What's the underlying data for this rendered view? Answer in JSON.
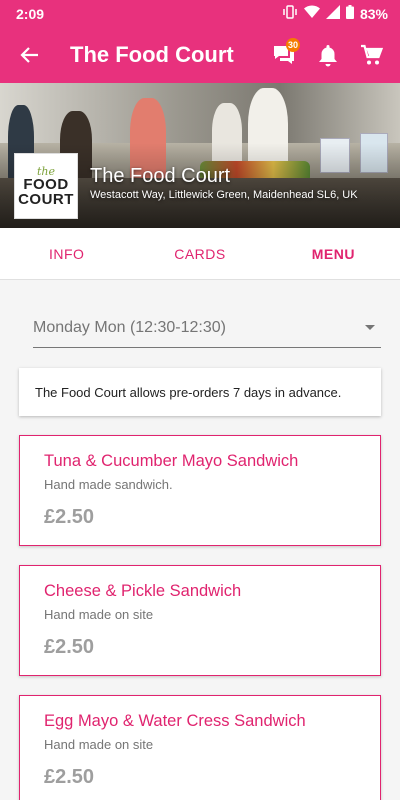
{
  "status": {
    "time": "2:09",
    "battery": "83%"
  },
  "app_bar": {
    "title": "The Food Court",
    "chat_badge": "30"
  },
  "hero": {
    "name": "The Food Court",
    "address": "Westacott Way, Littlewick Green, Maidenhead SL6, UK",
    "logo": {
      "the": "the",
      "food": "FOOD",
      "court": "COURT"
    }
  },
  "tabs": [
    {
      "label": "INFO"
    },
    {
      "label": "CARDS"
    },
    {
      "label": "MENU"
    }
  ],
  "day_select": {
    "value": "Monday Mon (12:30-12:30)"
  },
  "notice": "The Food Court allows pre-orders 7 days in advance.",
  "items": [
    {
      "title": "Tuna & Cucumber Mayo Sandwich",
      "desc": "Hand made sandwich.",
      "price": "£2.50"
    },
    {
      "title": "Cheese & Pickle Sandwich",
      "desc": "Hand made on site",
      "price": "£2.50"
    },
    {
      "title": "Egg Mayo & Water Cress Sandwich",
      "desc": "Hand made on site",
      "price": "£2.50"
    }
  ],
  "colors": {
    "primary": "#e8317d",
    "accent_text": "#e0246f",
    "badge": "#f57c00"
  }
}
